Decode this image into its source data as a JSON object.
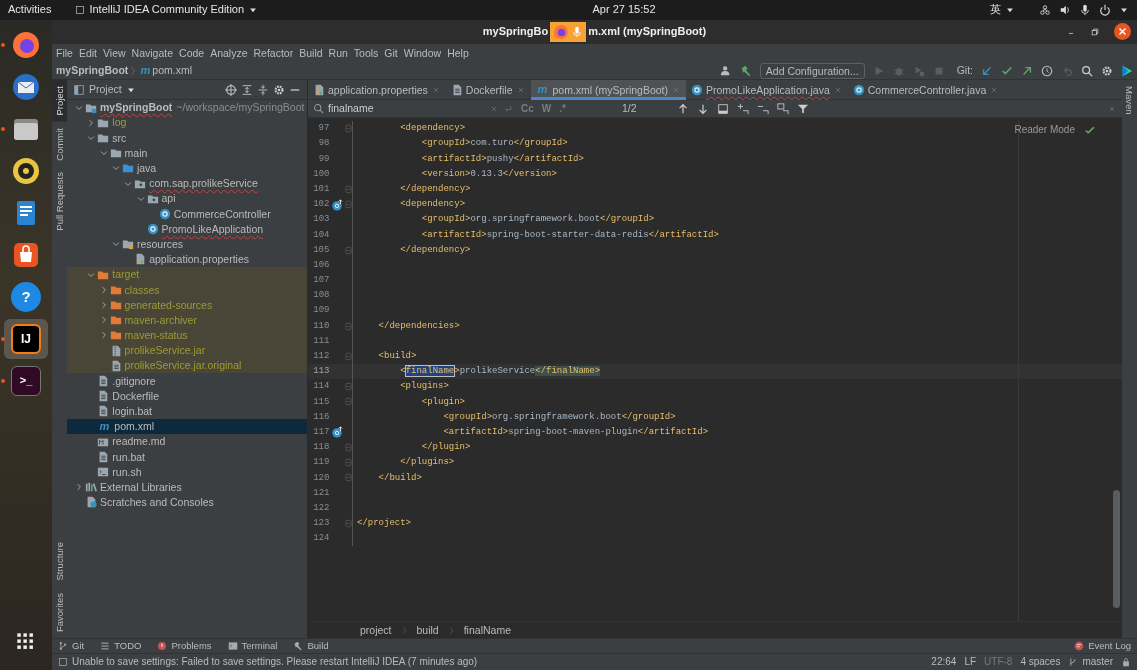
{
  "top_bar": {
    "activities": "Activities",
    "app_menu": "IntelliJ IDEA Community Edition",
    "clock": "Apr 27  15:52",
    "input_method": "英"
  },
  "dock": [
    {
      "kind": "browser",
      "running": true,
      "selected": false
    },
    {
      "kind": "mail",
      "running": false,
      "selected": false
    },
    {
      "kind": "files",
      "running": true,
      "selected": false
    },
    {
      "kind": "music",
      "running": false,
      "selected": false
    },
    {
      "kind": "writer",
      "running": false,
      "selected": false
    },
    {
      "kind": "store",
      "running": false,
      "selected": false
    },
    {
      "kind": "help",
      "glyph": "?",
      "running": false,
      "selected": false
    },
    {
      "kind": "ide",
      "glyph": "IJ",
      "running": true,
      "selected": true
    },
    {
      "kind": "terminal",
      "glyph": ">_",
      "running": true,
      "selected": false
    }
  ],
  "window": {
    "title_parts": [
      "mySpringBo",
      "m.xml (mySpringBoot)"
    ]
  },
  "menu": [
    "File",
    "Edit",
    "View",
    "Navigate",
    "Code",
    "Analyze",
    "Refactor",
    "Build",
    "Run",
    "Tools",
    "Git",
    "Window",
    "Help"
  ],
  "nav_bar": {
    "project": "mySpringBoot",
    "file_glyph": "m",
    "file": "pom.xml",
    "run_config": "Add Configuration...",
    "git_label": "Git:"
  },
  "left_stripe": {
    "top": [
      {
        "label": "Project",
        "selected": true
      },
      {
        "label": "Commit",
        "selected": false
      },
      {
        "label": "Pull Requests",
        "selected": false
      }
    ],
    "bottom": [
      {
        "label": "Structure",
        "selected": false
      },
      {
        "label": "Favorites",
        "selected": false
      }
    ]
  },
  "project_panel": {
    "title": "Project",
    "tree": [
      {
        "label": "mySpringBoot",
        "path": "~/workspace/mySpringBoot",
        "kind": "module",
        "expanded": true,
        "selected": false,
        "ignored": false,
        "excluded": false,
        "typo": true,
        "children": [
          {
            "label": "log",
            "kind": "folder",
            "expanded": false,
            "selected": false,
            "ignored": true,
            "excluded": false,
            "typo": false
          },
          {
            "label": "src",
            "kind": "folder",
            "expanded": true,
            "selected": false,
            "ignored": false,
            "excluded": false,
            "typo": false,
            "children": [
              {
                "label": "main",
                "kind": "folder",
                "expanded": true,
                "selected": false,
                "ignored": false,
                "excluded": false,
                "typo": false,
                "children": [
                  {
                    "label": "java",
                    "kind": "source-folder",
                    "expanded": true,
                    "selected": false,
                    "ignored": false,
                    "excluded": false,
                    "typo": false,
                    "children": [
                      {
                        "label": "com.sap.prolikeService",
                        "kind": "package",
                        "expanded": true,
                        "selected": false,
                        "ignored": false,
                        "excluded": false,
                        "typo": true,
                        "children": [
                          {
                            "label": "api",
                            "kind": "package",
                            "expanded": true,
                            "selected": false,
                            "ignored": false,
                            "excluded": false,
                            "typo": false,
                            "children": [
                              {
                                "label": "CommerceController",
                                "kind": "class",
                                "selected": false,
                                "ignored": false,
                                "excluded": false,
                                "typo": false
                              }
                            ]
                          },
                          {
                            "label": "PromoLikeApplication",
                            "kind": "class",
                            "selected": false,
                            "ignored": false,
                            "excluded": false,
                            "typo": true
                          }
                        ]
                      }
                    ]
                  },
                  {
                    "label": "resources",
                    "kind": "resources-folder",
                    "expanded": true,
                    "selected": false,
                    "ignored": false,
                    "excluded": false,
                    "typo": false,
                    "children": [
                      {
                        "label": "application.properties",
                        "kind": "properties",
                        "selected": false,
                        "ignored": false,
                        "excluded": false,
                        "typo": false
                      }
                    ]
                  }
                ]
              }
            ]
          },
          {
            "label": "target",
            "kind": "excluded-folder",
            "expanded": true,
            "selected": false,
            "ignored": true,
            "excluded": true,
            "typo": false,
            "children": [
              {
                "label": "classes",
                "kind": "excluded-folder",
                "expanded": false,
                "selected": false,
                "ignored": true,
                "excluded": true,
                "typo": false
              },
              {
                "label": "generated-sources",
                "kind": "excluded-folder",
                "expanded": false,
                "selected": false,
                "ignored": true,
                "excluded": true,
                "typo": false
              },
              {
                "label": "maven-archiver",
                "kind": "excluded-folder",
                "expanded": false,
                "selected": false,
                "ignored": true,
                "excluded": true,
                "typo": false
              },
              {
                "label": "maven-status",
                "kind": "excluded-folder",
                "expanded": false,
                "selected": false,
                "ignored": true,
                "excluded": true,
                "typo": false
              },
              {
                "label": "prolikeService.jar",
                "kind": "jar",
                "selected": false,
                "ignored": true,
                "excluded": true,
                "typo": false
              },
              {
                "label": "prolikeService.jar.original",
                "kind": "file",
                "selected": false,
                "ignored": true,
                "excluded": true,
                "typo": false
              }
            ]
          },
          {
            "label": ".gitignore",
            "kind": "file",
            "selected": false,
            "ignored": false,
            "excluded": false,
            "typo": false
          },
          {
            "label": "Dockerfile",
            "kind": "file",
            "selected": false,
            "ignored": false,
            "excluded": false,
            "typo": false
          },
          {
            "label": "login.bat",
            "kind": "file",
            "selected": false,
            "ignored": false,
            "excluded": false,
            "typo": false
          },
          {
            "label": "pom.xml",
            "kind": "maven",
            "glyph": "m",
            "selected": true,
            "ignored": false,
            "excluded": false,
            "typo": false
          },
          {
            "label": "readme.md",
            "kind": "markdown",
            "selected": false,
            "ignored": false,
            "excluded": false,
            "typo": false
          },
          {
            "label": "run.bat",
            "kind": "file",
            "selected": false,
            "ignored": false,
            "excluded": false,
            "typo": false
          },
          {
            "label": "run.sh",
            "kind": "shell",
            "selected": false,
            "ignored": false,
            "excluded": false,
            "typo": false
          }
        ]
      },
      {
        "label": "External Libraries",
        "kind": "library",
        "expanded": false,
        "selected": false,
        "ignored": false,
        "excluded": false,
        "typo": false
      },
      {
        "label": "Scratches and Consoles",
        "kind": "scratches",
        "selected": false,
        "ignored": false,
        "excluded": false,
        "typo": false
      }
    ]
  },
  "editor_tabs": [
    {
      "label": "application.properties",
      "kind": "properties",
      "selected": false,
      "typo": false
    },
    {
      "label": "Dockerfile",
      "kind": "file",
      "selected": false,
      "typo": false
    },
    {
      "label": "pom.xml (mySpringBoot)",
      "kind": "maven",
      "glyph": "m",
      "selected": true,
      "typo": false
    },
    {
      "label": "PromoLikeApplication.java",
      "kind": "class",
      "selected": false,
      "typo": true
    },
    {
      "label": "CommerceController.java",
      "kind": "class",
      "selected": false,
      "typo": false
    }
  ],
  "find_bar": {
    "query": "finalname",
    "options": [
      "Cc",
      "W",
      ".*"
    ],
    "match_count": "1/2"
  },
  "reader_mode": "Reader Mode",
  "code_lines": [
    {
      "number": "97",
      "text": "        <dependency>",
      "fold": true,
      "marker": false,
      "current": false
    },
    {
      "number": "98",
      "text": "            <groupId>com.turo</groupId>",
      "fold": false,
      "marker": false,
      "current": false
    },
    {
      "number": "99",
      "text": "            <artifactId>pushy</artifactId>",
      "fold": false,
      "marker": false,
      "current": false
    },
    {
      "number": "100",
      "text": "            <version>0.13.3</version>",
      "fold": false,
      "marker": false,
      "current": false
    },
    {
      "number": "101",
      "text": "        </dependency>",
      "fold": true,
      "marker": false,
      "current": false
    },
    {
      "number": "102",
      "text": "        <dependency>",
      "fold": true,
      "marker": true,
      "current": false
    },
    {
      "number": "103",
      "text": "            <groupId>org.springframework.boot</groupId>",
      "fold": false,
      "marker": false,
      "current": false
    },
    {
      "number": "104",
      "text": "            <artifactId>spring-boot-starter-data-redis</artifactId>",
      "fold": false,
      "marker": false,
      "current": false
    },
    {
      "number": "105",
      "text": "        </dependency>",
      "fold": true,
      "marker": false,
      "current": false
    },
    {
      "number": "106",
      "fold": false,
      "marker": false,
      "current": false
    },
    {
      "number": "107",
      "fold": false,
      "marker": false,
      "current": false
    },
    {
      "number": "108",
      "fold": false,
      "marker": false,
      "current": false
    },
    {
      "number": "109",
      "fold": false,
      "marker": false,
      "current": false
    },
    {
      "number": "110",
      "text": "    </dependencies>",
      "fold": true,
      "marker": false,
      "current": false
    },
    {
      "number": "111",
      "fold": false,
      "marker": false,
      "current": false
    },
    {
      "number": "112",
      "text": "    <build>",
      "fold": true,
      "marker": false,
      "current": false
    },
    {
      "number": "113",
      "segments": [
        {
          "text": "        <",
          "kind": "plain"
        },
        {
          "text": "finalName",
          "kind": "search-match"
        },
        {
          "text": ">prolikeService",
          "kind": "plain"
        },
        {
          "text": "</finalName>",
          "kind": "tag-match"
        }
      ],
      "fold": false,
      "marker": false,
      "current": true
    },
    {
      "number": "114",
      "text": "        <plugins>",
      "fold": true,
      "marker": false,
      "current": false
    },
    {
      "number": "115",
      "text": "            <plugin>",
      "fold": true,
      "marker": false,
      "current": false
    },
    {
      "number": "116",
      "text": "                <groupId>org.springframework.boot</groupId>",
      "fold": false,
      "marker": false,
      "current": false
    },
    {
      "number": "117",
      "text": "                <artifactId>spring-boot-maven-plugin</artifactId>",
      "fold": false,
      "marker": true,
      "current": false
    },
    {
      "number": "118",
      "text": "            </plugin>",
      "fold": true,
      "marker": false,
      "current": false
    },
    {
      "number": "119",
      "text": "        </plugins>",
      "fold": true,
      "marker": false,
      "current": false
    },
    {
      "number": "120",
      "text": "    </build>",
      "fold": true,
      "marker": false,
      "current": false
    },
    {
      "number": "121",
      "fold": false,
      "marker": false,
      "current": false
    },
    {
      "number": "122",
      "fold": false,
      "marker": false,
      "current": false
    },
    {
      "number": "123",
      "text": "</project>",
      "fold": true,
      "marker": false,
      "current": false
    },
    {
      "number": "124",
      "fold": false,
      "marker": false,
      "current": false
    }
  ],
  "breadcrumbs": [
    "project",
    "build",
    "finalName"
  ],
  "right_stripe": [
    {
      "label": "Maven",
      "selected": false
    }
  ],
  "bottom_tools": [
    {
      "label": "Git",
      "kind": "git"
    },
    {
      "label": "TODO",
      "kind": "todo"
    },
    {
      "label": "Problems",
      "kind": "problems"
    },
    {
      "label": "Terminal",
      "kind": "terminal"
    },
    {
      "label": "Build",
      "kind": "build"
    }
  ],
  "event_log": "Event Log",
  "status_bar": {
    "message": "Unable to save settings: Failed to save settings. Please restart IntelliJ IDEA (7 minutes ago)",
    "position": "22:64",
    "line_separator": "LF",
    "encoding": "UTF-8",
    "indent": "4 spaces",
    "branch": "master"
  }
}
